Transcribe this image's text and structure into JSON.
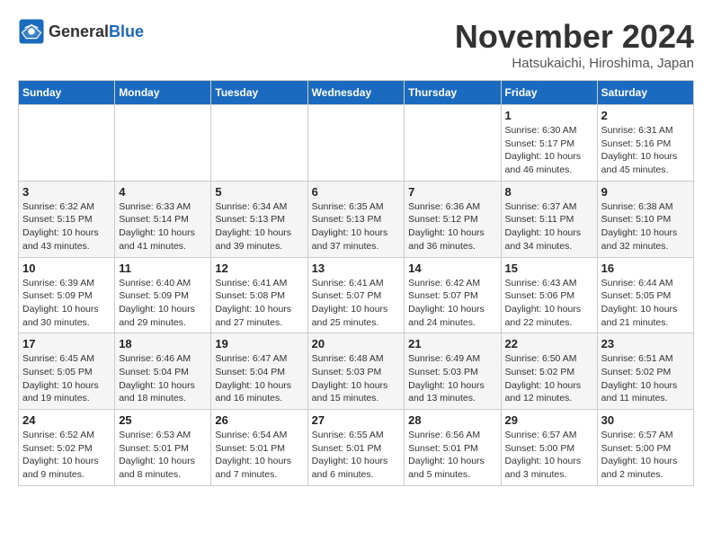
{
  "logo": {
    "general": "General",
    "blue": "Blue"
  },
  "title": "November 2024",
  "location": "Hatsukaichi, Hiroshima, Japan",
  "weekdays": [
    "Sunday",
    "Monday",
    "Tuesday",
    "Wednesday",
    "Thursday",
    "Friday",
    "Saturday"
  ],
  "weeks": [
    [
      {
        "day": "",
        "info": ""
      },
      {
        "day": "",
        "info": ""
      },
      {
        "day": "",
        "info": ""
      },
      {
        "day": "",
        "info": ""
      },
      {
        "day": "",
        "info": ""
      },
      {
        "day": "1",
        "info": "Sunrise: 6:30 AM\nSunset: 5:17 PM\nDaylight: 10 hours\nand 46 minutes."
      },
      {
        "day": "2",
        "info": "Sunrise: 6:31 AM\nSunset: 5:16 PM\nDaylight: 10 hours\nand 45 minutes."
      }
    ],
    [
      {
        "day": "3",
        "info": "Sunrise: 6:32 AM\nSunset: 5:15 PM\nDaylight: 10 hours\nand 43 minutes."
      },
      {
        "day": "4",
        "info": "Sunrise: 6:33 AM\nSunset: 5:14 PM\nDaylight: 10 hours\nand 41 minutes."
      },
      {
        "day": "5",
        "info": "Sunrise: 6:34 AM\nSunset: 5:13 PM\nDaylight: 10 hours\nand 39 minutes."
      },
      {
        "day": "6",
        "info": "Sunrise: 6:35 AM\nSunset: 5:13 PM\nDaylight: 10 hours\nand 37 minutes."
      },
      {
        "day": "7",
        "info": "Sunrise: 6:36 AM\nSunset: 5:12 PM\nDaylight: 10 hours\nand 36 minutes."
      },
      {
        "day": "8",
        "info": "Sunrise: 6:37 AM\nSunset: 5:11 PM\nDaylight: 10 hours\nand 34 minutes."
      },
      {
        "day": "9",
        "info": "Sunrise: 6:38 AM\nSunset: 5:10 PM\nDaylight: 10 hours\nand 32 minutes."
      }
    ],
    [
      {
        "day": "10",
        "info": "Sunrise: 6:39 AM\nSunset: 5:09 PM\nDaylight: 10 hours\nand 30 minutes."
      },
      {
        "day": "11",
        "info": "Sunrise: 6:40 AM\nSunset: 5:09 PM\nDaylight: 10 hours\nand 29 minutes."
      },
      {
        "day": "12",
        "info": "Sunrise: 6:41 AM\nSunset: 5:08 PM\nDaylight: 10 hours\nand 27 minutes."
      },
      {
        "day": "13",
        "info": "Sunrise: 6:41 AM\nSunset: 5:07 PM\nDaylight: 10 hours\nand 25 minutes."
      },
      {
        "day": "14",
        "info": "Sunrise: 6:42 AM\nSunset: 5:07 PM\nDaylight: 10 hours\nand 24 minutes."
      },
      {
        "day": "15",
        "info": "Sunrise: 6:43 AM\nSunset: 5:06 PM\nDaylight: 10 hours\nand 22 minutes."
      },
      {
        "day": "16",
        "info": "Sunrise: 6:44 AM\nSunset: 5:05 PM\nDaylight: 10 hours\nand 21 minutes."
      }
    ],
    [
      {
        "day": "17",
        "info": "Sunrise: 6:45 AM\nSunset: 5:05 PM\nDaylight: 10 hours\nand 19 minutes."
      },
      {
        "day": "18",
        "info": "Sunrise: 6:46 AM\nSunset: 5:04 PM\nDaylight: 10 hours\nand 18 minutes."
      },
      {
        "day": "19",
        "info": "Sunrise: 6:47 AM\nSunset: 5:04 PM\nDaylight: 10 hours\nand 16 minutes."
      },
      {
        "day": "20",
        "info": "Sunrise: 6:48 AM\nSunset: 5:03 PM\nDaylight: 10 hours\nand 15 minutes."
      },
      {
        "day": "21",
        "info": "Sunrise: 6:49 AM\nSunset: 5:03 PM\nDaylight: 10 hours\nand 13 minutes."
      },
      {
        "day": "22",
        "info": "Sunrise: 6:50 AM\nSunset: 5:02 PM\nDaylight: 10 hours\nand 12 minutes."
      },
      {
        "day": "23",
        "info": "Sunrise: 6:51 AM\nSunset: 5:02 PM\nDaylight: 10 hours\nand 11 minutes."
      }
    ],
    [
      {
        "day": "24",
        "info": "Sunrise: 6:52 AM\nSunset: 5:02 PM\nDaylight: 10 hours\nand 9 minutes."
      },
      {
        "day": "25",
        "info": "Sunrise: 6:53 AM\nSunset: 5:01 PM\nDaylight: 10 hours\nand 8 minutes."
      },
      {
        "day": "26",
        "info": "Sunrise: 6:54 AM\nSunset: 5:01 PM\nDaylight: 10 hours\nand 7 minutes."
      },
      {
        "day": "27",
        "info": "Sunrise: 6:55 AM\nSunset: 5:01 PM\nDaylight: 10 hours\nand 6 minutes."
      },
      {
        "day": "28",
        "info": "Sunrise: 6:56 AM\nSunset: 5:01 PM\nDaylight: 10 hours\nand 5 minutes."
      },
      {
        "day": "29",
        "info": "Sunrise: 6:57 AM\nSunset: 5:00 PM\nDaylight: 10 hours\nand 3 minutes."
      },
      {
        "day": "30",
        "info": "Sunrise: 6:57 AM\nSunset: 5:00 PM\nDaylight: 10 hours\nand 2 minutes."
      }
    ]
  ]
}
